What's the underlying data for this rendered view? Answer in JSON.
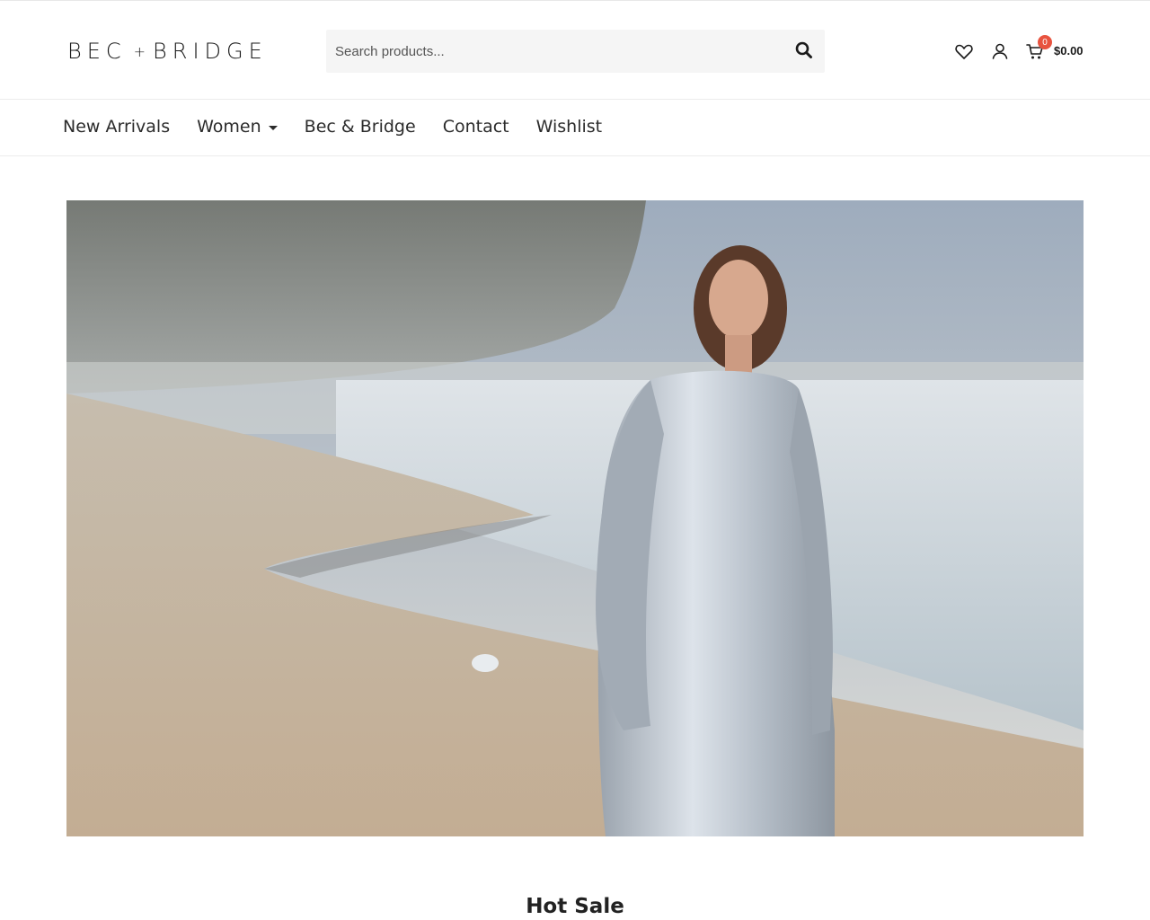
{
  "brand": {
    "left": "BEC",
    "plus": "+",
    "right": "BRIDGE"
  },
  "search": {
    "placeholder": "Search products..."
  },
  "header_icons": [
    "heart-icon",
    "user-icon",
    "cart-icon"
  ],
  "cart": {
    "count": "0",
    "total": "$0.00"
  },
  "colors": {
    "badge": "#e8533f",
    "text": "#222222",
    "search_bg": "#f5f5f5"
  },
  "nav": {
    "items": [
      {
        "label": "New Arrivals"
      },
      {
        "label": "Women"
      },
      {
        "label": "Bec & Bridge"
      },
      {
        "label": "Contact"
      },
      {
        "label": "Wishlist"
      }
    ]
  },
  "hero": {
    "description": ""
  },
  "section": {
    "title": "Hot Sale"
  }
}
